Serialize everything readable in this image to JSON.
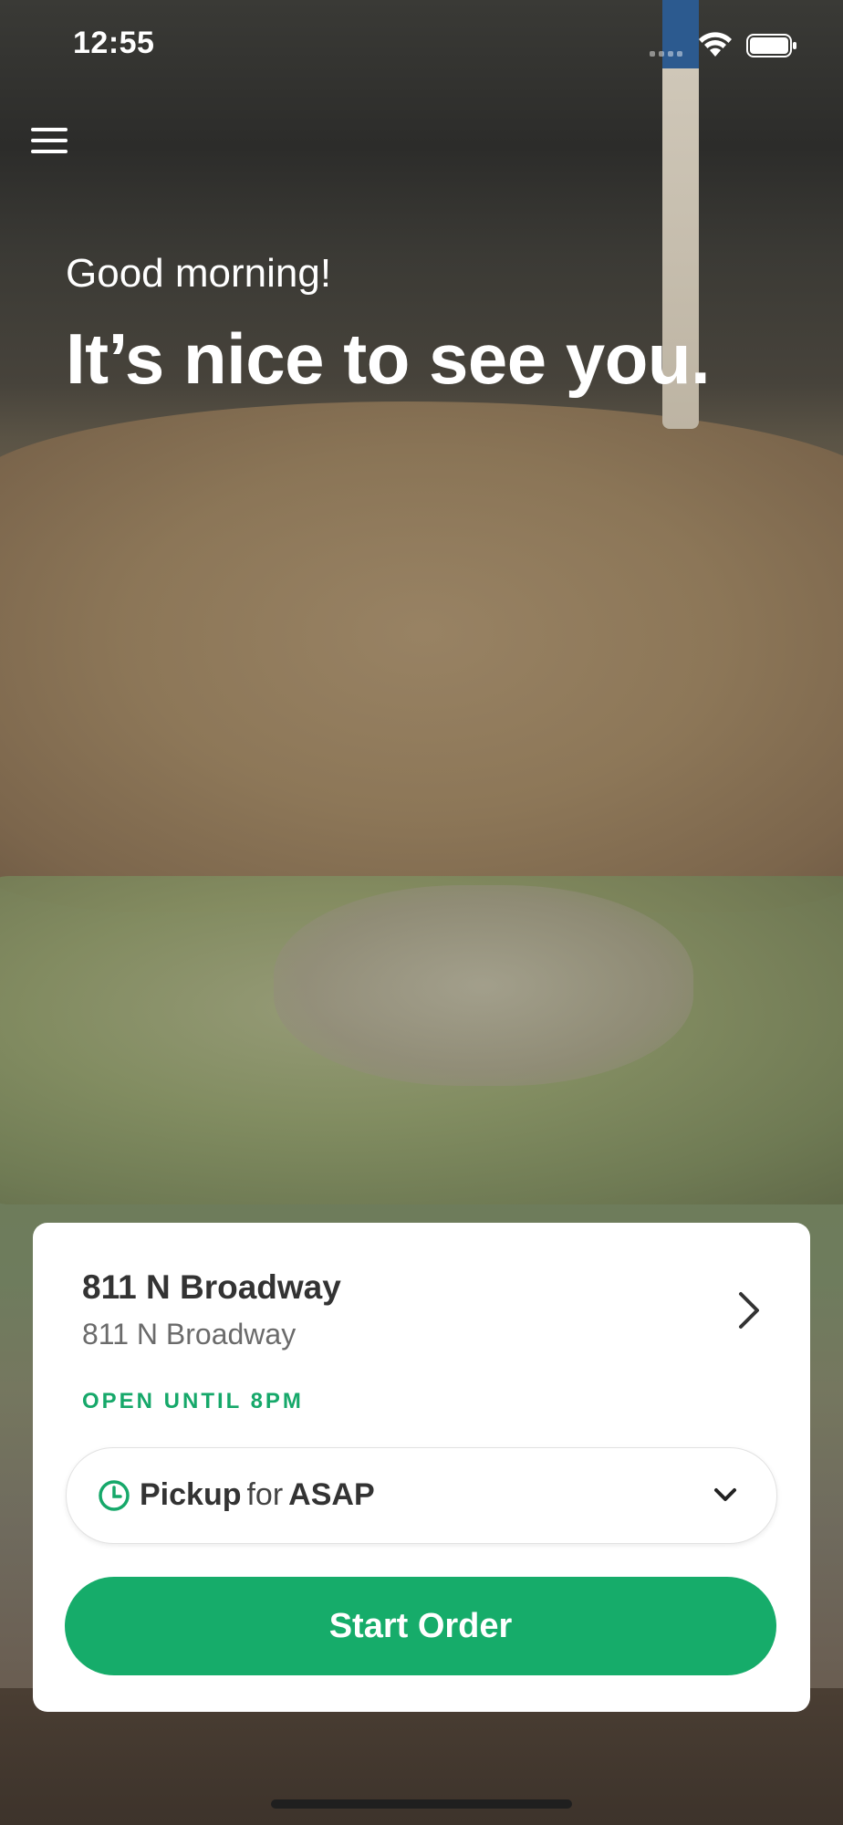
{
  "status_bar": {
    "time": "12:55"
  },
  "greeting": {
    "subtitle": "Good morning!",
    "title": "It’s nice to see you."
  },
  "store_card": {
    "name": "811 N Broadway",
    "address": "811 N Broadway",
    "hours_status": "OPEN UNTIL 8PM",
    "order_mode": {
      "type": "Pickup",
      "connector": "for",
      "time": "ASAP"
    },
    "start_button_label": "Start Order"
  },
  "icons": [
    "menu-icon",
    "wifi-icon",
    "battery-icon",
    "signal-icon",
    "chevron-right-icon",
    "clock-icon",
    "chevron-down-icon"
  ],
  "colors": {
    "accent_green": "#16ac6a",
    "status_green": "#16a86a",
    "card_bg": "#ffffff"
  }
}
